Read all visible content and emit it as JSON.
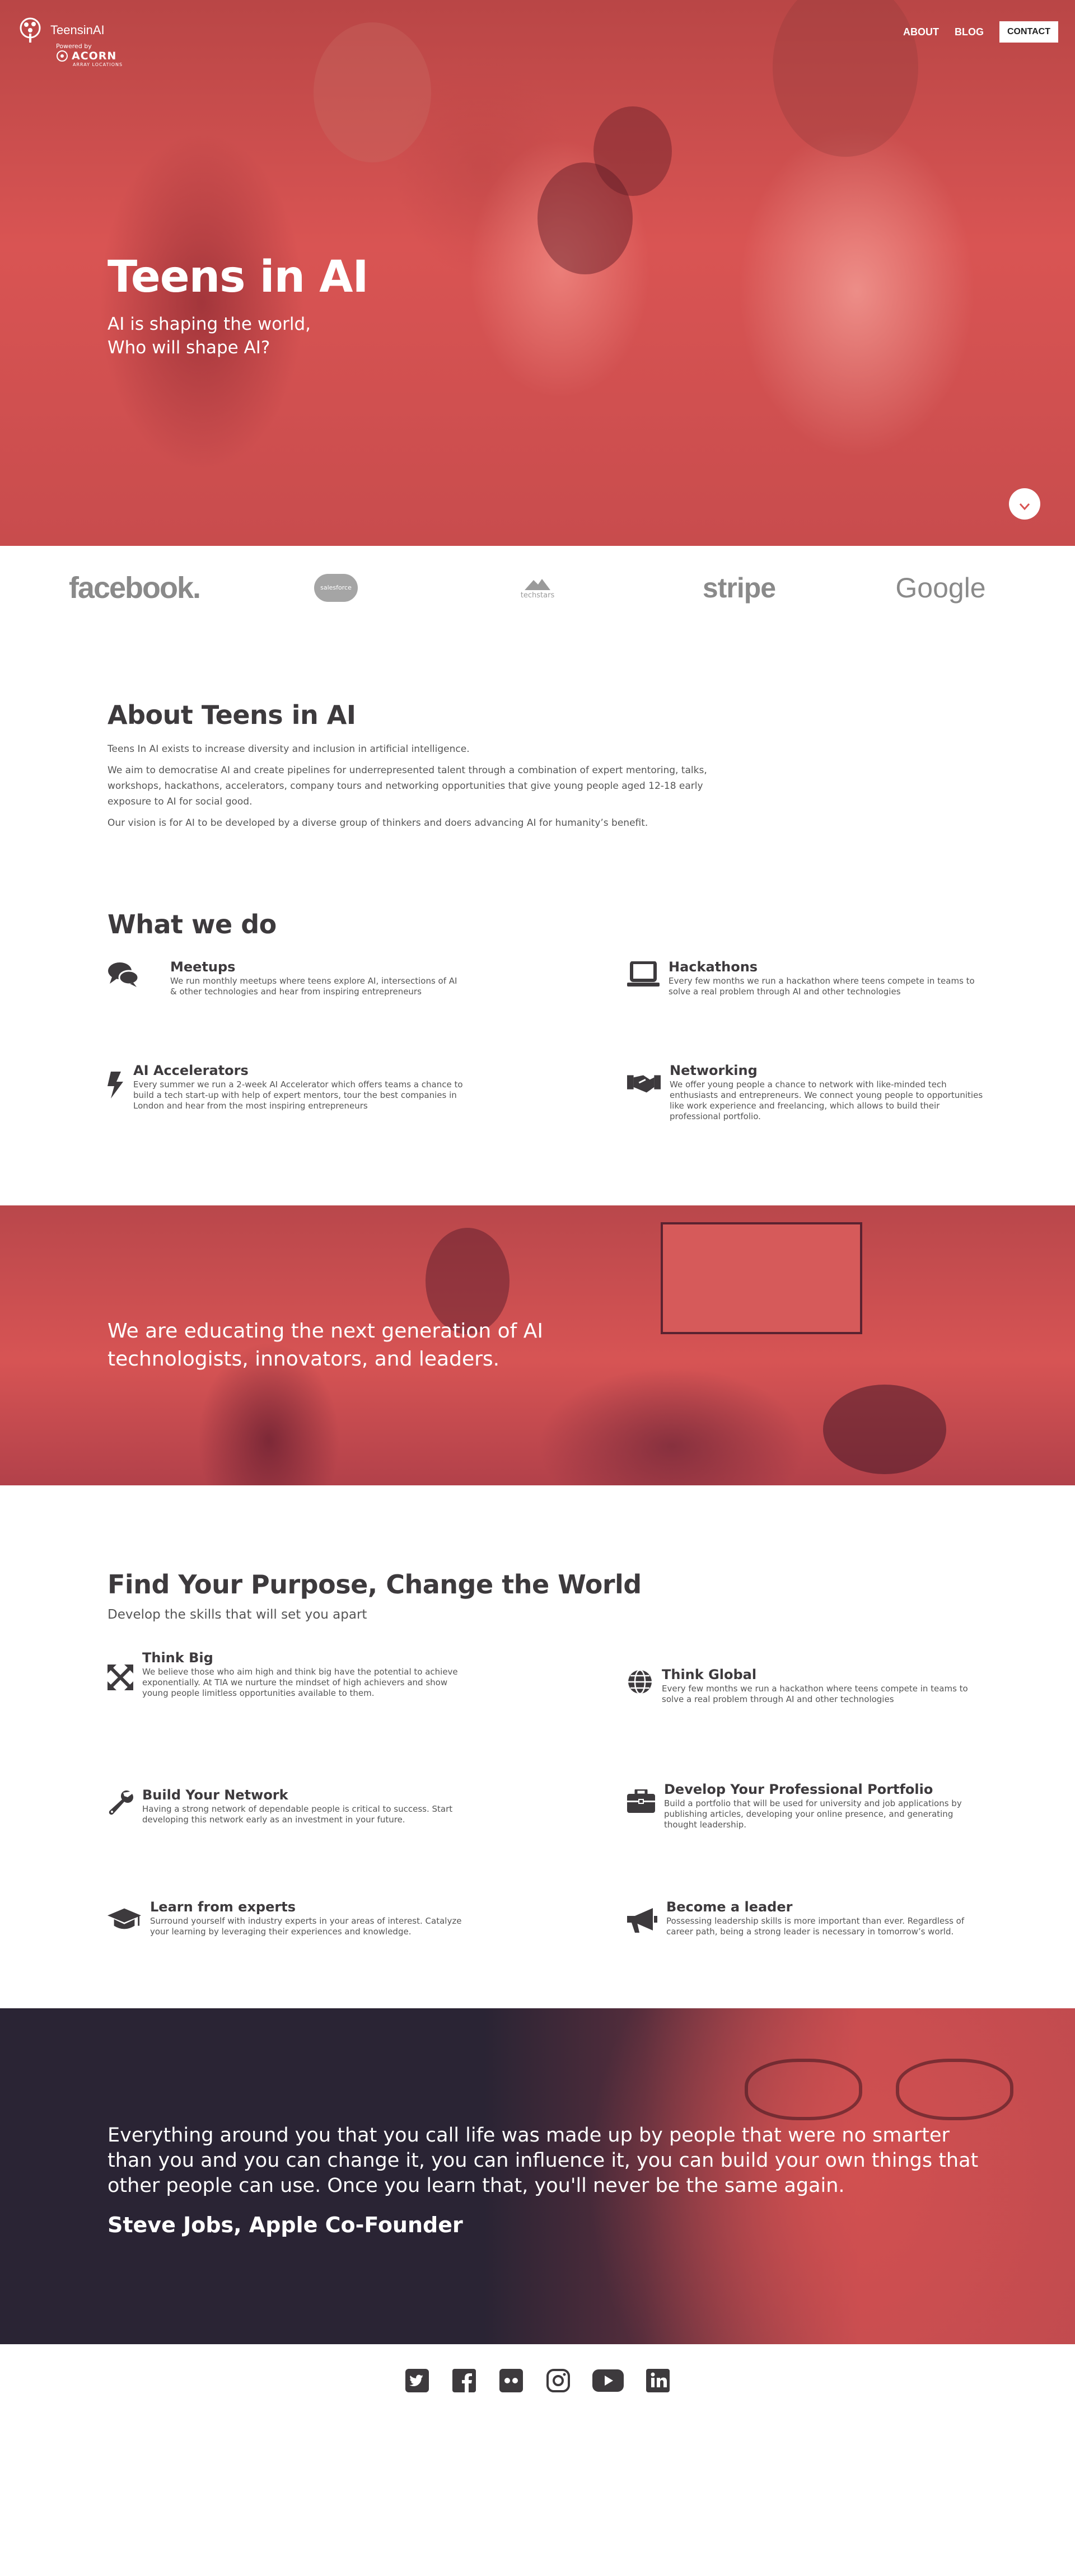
{
  "nav": {
    "brand": "TeensinAI",
    "powered_by": "Powered by",
    "partner": "ACORN",
    "partner_sub": "ARRAY LOCATIONS",
    "links": [
      "ABOUT",
      "BLOG"
    ],
    "contact": "CONTACT"
  },
  "hero": {
    "title": "Teens in AI",
    "subtitle_line1": "AI is shaping the world,",
    "subtitle_line2": "Who will shape AI?",
    "scroll_icon": "chevron-down-icon"
  },
  "partners": [
    "facebook.",
    "salesforce",
    "techstars",
    "stripe",
    "Google"
  ],
  "about": {
    "title": "About Teens in AI",
    "p1": "Teens In AI exists to increase diversity and inclusion in artificial intelligence.",
    "p2": "We aim to democratise AI and create pipelines for underrepresented talent through a combination of expert mentoring, talks, workshops, hackathons, accelerators, company tours and networking opportunities that give young people aged 12-18 early exposure to AI for social good.",
    "p3": "Our vision is for AI to be developed by a diverse group of thinkers and doers advancing AI for humanity’s benefit."
  },
  "what_we_do": {
    "title": "What we do",
    "items": [
      {
        "icon": "comments-icon",
        "title": "Meetups",
        "text": "We run monthly meetups where teens explore AI, intersections of AI & other technologies and hear from inspiring entrepreneurs"
      },
      {
        "icon": "laptop-icon",
        "title": "Hackathons",
        "text": "Every few months we run a hackathon where teens compete in teams to solve a real problem through AI and other technologies"
      },
      {
        "icon": "bolt-icon",
        "title": "AI Accelerators",
        "text": "Every summer we run a 2-week AI Accelerator which offers teams a chance to build a tech start-up with help of expert mentors, tour the best companies in London and hear from the most inspiring entrepreneurs"
      },
      {
        "icon": "handshake-icon",
        "title": "Networking",
        "text": "We offer young people a chance to network with like-minded tech enthusiasts and entrepreneurs. We connect young people to opportunities like work experience and freelancing, which allows to build their professional portfolio."
      }
    ]
  },
  "banner": {
    "text": "We are educating the next generation of AI technologists, innovators, and leaders."
  },
  "purpose": {
    "title": "Find Your Purpose, Change the World",
    "subtitle": "Develop the skills that will set you apart",
    "items": [
      {
        "icon": "expand-arrows-icon",
        "title": "Think Big",
        "text": "We believe those who aim high and think big have the potential to achieve exponentially. At TIA we nurture the mindset of high achievers and show young people limitless opportunities available to them."
      },
      {
        "icon": "globe-icon",
        "title": "Think Global",
        "text": "Every few months we run a hackathon where teens compete in teams to solve a real problem through AI and other technologies"
      },
      {
        "icon": "wrench-icon",
        "title": "Build Your Network",
        "text": "Having a strong network of dependable people is critical to success. Start developing this network early as an investment in your future."
      },
      {
        "icon": "briefcase-icon",
        "title": "Develop Your Professional Portfolio",
        "text": "Build a portfolio that will be used for university and job applications by publishing articles, developing your online presence, and generating thought leadership."
      },
      {
        "icon": "graduation-cap-icon",
        "title": "Learn from experts",
        "text": "Surround yourself with industry experts in your areas of interest. Catalyze your learning by leveraging their experiences and knowledge."
      },
      {
        "icon": "bullhorn-icon",
        "title": "Become a leader",
        "text": "Possessing leadership skills is more important than ever. Regardless of career path, being a strong leader is necessary in tomorrow’s world."
      }
    ]
  },
  "quote": {
    "text": "Everything around you that you call life was made up by people that were no smarter than you and you can change it, you can influence it, you can build your own things that other people can use. Once you learn that, you'll never be the same again.",
    "author": "Steve Jobs, Apple Co-Founder"
  },
  "footer": {
    "social": [
      "twitter-icon",
      "facebook-icon",
      "flickr-icon",
      "instagram-icon",
      "youtube-icon",
      "linkedin-icon"
    ]
  },
  "colors": {
    "brand_red": "#d95453",
    "dark_text": "#3d3a3d",
    "quote_bg": "#2a2434"
  }
}
